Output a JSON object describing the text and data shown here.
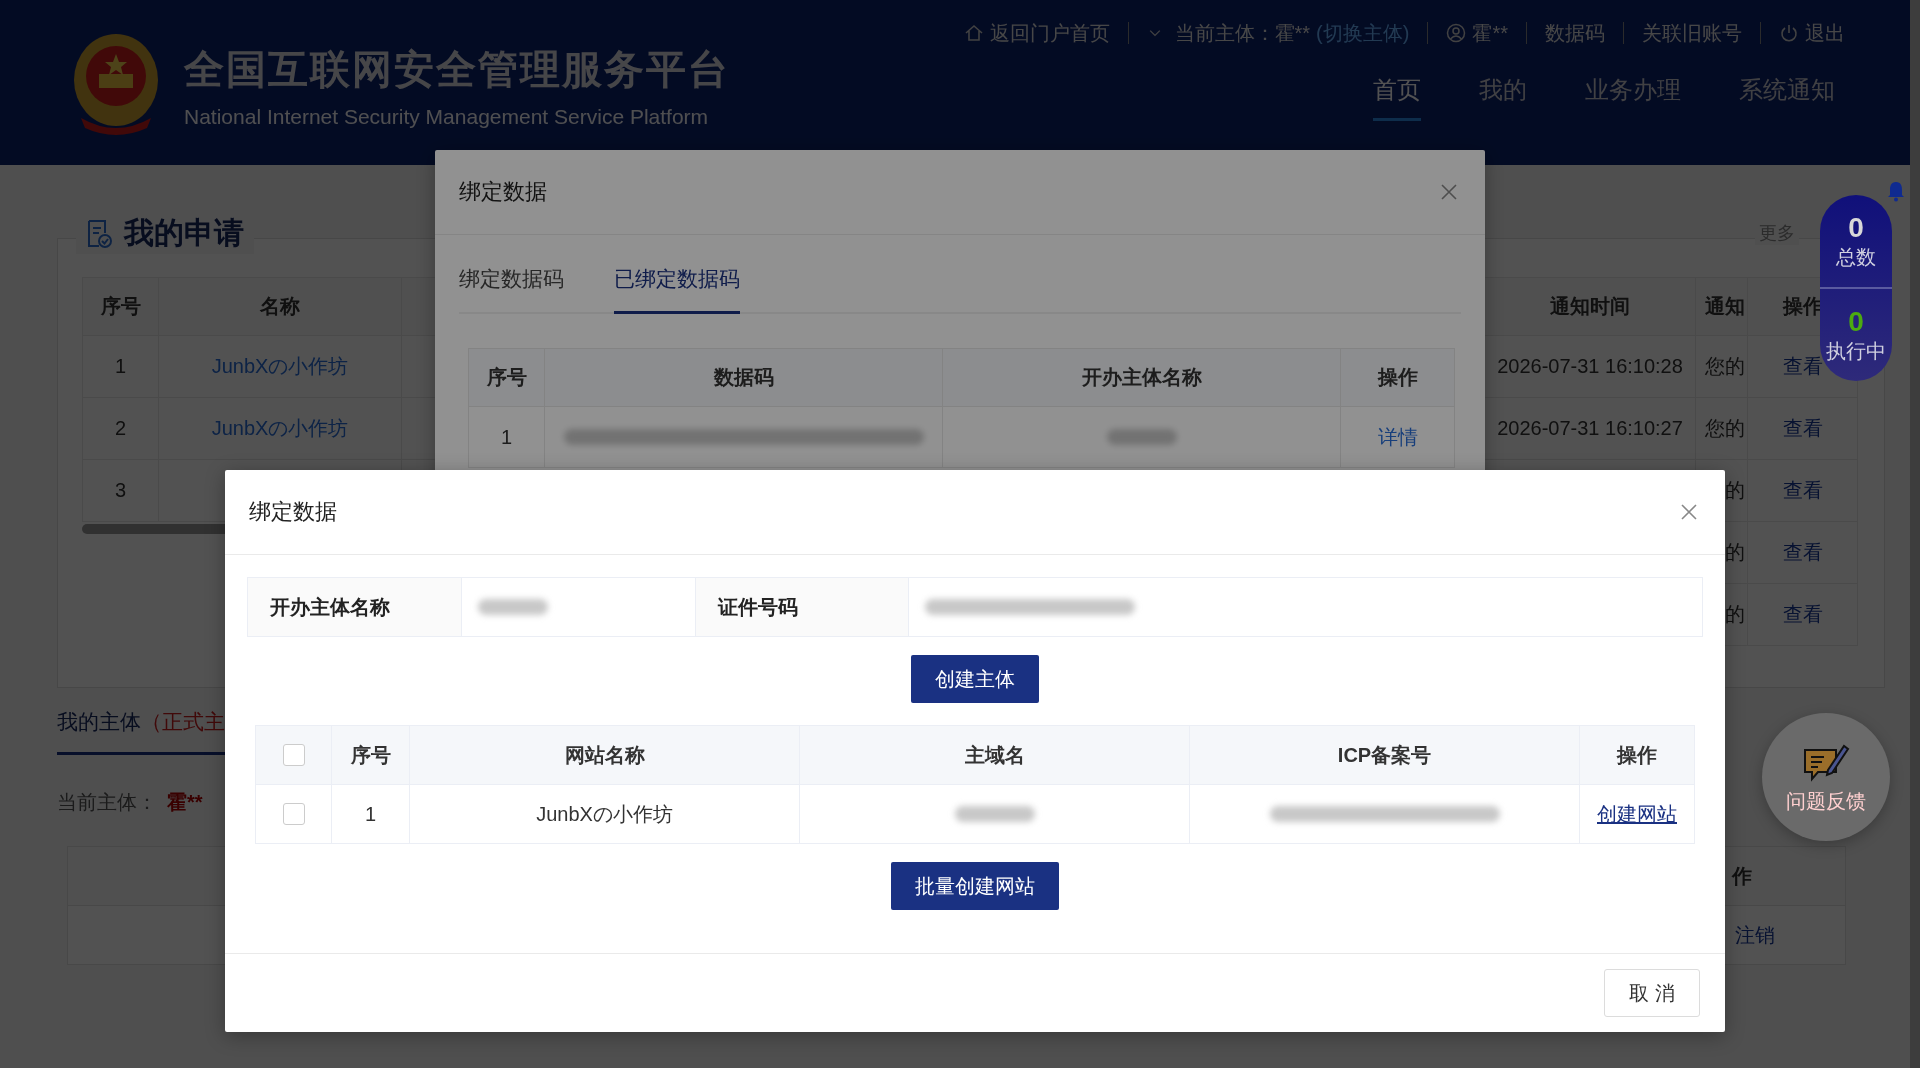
{
  "header": {
    "title": "全国互联网安全管理服务平台",
    "subtitle": "National Internet Security Management Service Platform",
    "top_links": [
      {
        "kind": "home",
        "label": "返回门户首页"
      },
      {
        "kind": "subject",
        "label": "当前主体：霍**",
        "extra": "(切换主体)"
      },
      {
        "kind": "user",
        "label": "霍**"
      },
      {
        "kind": "plain",
        "label": "数据码"
      },
      {
        "kind": "plain",
        "label": "关联旧账号"
      },
      {
        "kind": "logout",
        "label": "退出"
      }
    ],
    "nav": [
      {
        "label": "首页",
        "selected": true
      },
      {
        "label": "我的",
        "selected": false
      },
      {
        "label": "业务办理",
        "selected": false
      },
      {
        "label": "系统通知",
        "selected": false
      }
    ]
  },
  "applications": {
    "title": "我的申请",
    "columns": [
      "序号",
      "名称"
    ],
    "rows": [
      {
        "index": "1",
        "name": "JunbXの小作坊"
      },
      {
        "index": "2",
        "name": "JunbXの小作坊"
      },
      {
        "index": "3"
      }
    ]
  },
  "notices": {
    "more": "更多",
    "columns": [
      "通知时间",
      "通知",
      "操作"
    ],
    "rows": [
      {
        "time": "2026-07-31 16:10:28",
        "notice": "您的",
        "action": "查看"
      },
      {
        "time": "2026-07-31 16:10:27",
        "notice": "您的",
        "action": "查看"
      },
      {
        "notice": "的",
        "action": "查看"
      },
      {
        "notice": "的",
        "action": "查看"
      },
      {
        "notice": "的",
        "action": "查看"
      }
    ]
  },
  "my_subject": {
    "tab": "我的主体",
    "tab_note": "（正式主",
    "current_label": "当前主体：",
    "current_value": "霍**",
    "action_header": "作",
    "row_action": "注销"
  },
  "stats": [
    {
      "value": "0",
      "label": "总数",
      "color": "#d8d8d8"
    },
    {
      "value": "0",
      "label": "执行中",
      "color": "#4caa10"
    }
  ],
  "feedback": {
    "label": "问题反馈"
  },
  "dialog_back": {
    "title": "绑定数据",
    "tabs": [
      {
        "label": "绑定数据码",
        "selected": false
      },
      {
        "label": "已绑定数据码",
        "selected": true
      }
    ],
    "columns": [
      "序号",
      "数据码",
      "开办主体名称",
      "操作"
    ],
    "rows": [
      {
        "index": "1",
        "action": "详情"
      }
    ]
  },
  "dialog_front": {
    "title": "绑定数据",
    "info": [
      {
        "label": "开办主体名称"
      },
      {
        "label": "证件号码"
      }
    ],
    "create_subject": "创建主体",
    "header_checked": false,
    "columns": [
      "序号",
      "网站名称",
      "主域名",
      "ICP备案号",
      "操作"
    ],
    "rows": [
      {
        "checked": false,
        "index": "1",
        "site_name": "JunbXの小作坊",
        "action": "创建网站"
      }
    ],
    "batch_button": "批量创建网站",
    "cancel": "取 消"
  }
}
